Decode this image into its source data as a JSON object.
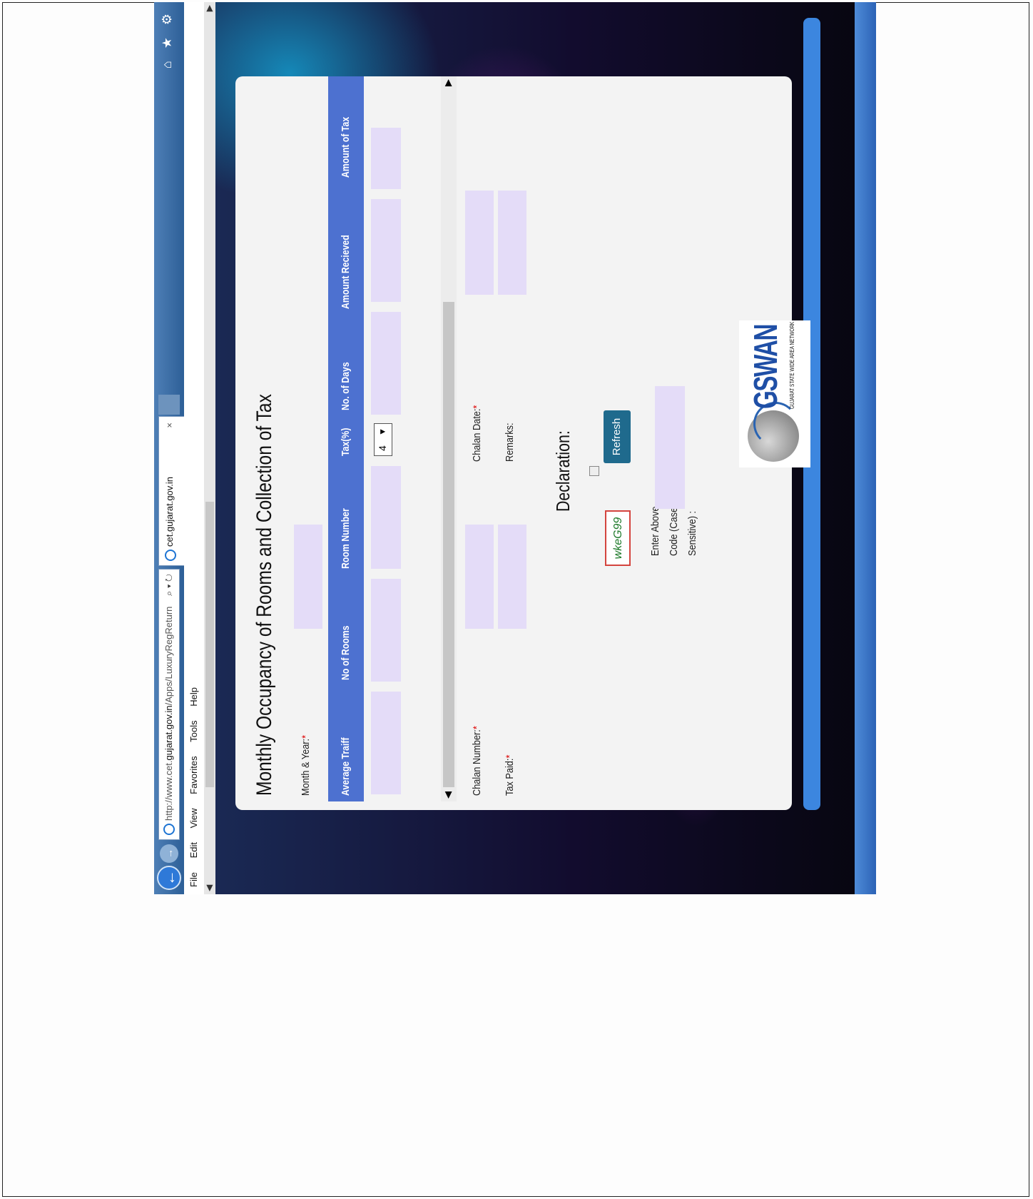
{
  "browser": {
    "url_prefix": "http://www.cet.",
    "url_domain": "gujarat.gov.in",
    "url_path": "/Apps/LuxuryRegReturn",
    "url_tools": "⌕ ▾ ↻",
    "tab_title": "cet.gujarat.gov.in",
    "tab_close": "×",
    "corner_icons": "⌂ ★ ⚙"
  },
  "menu": [
    "File",
    "Edit",
    "View",
    "Favorites",
    "Tools",
    "Help"
  ],
  "page": {
    "title": "Monthly Occupancy of Rooms and Collection of Tax",
    "month_year_label": "Month & Year:",
    "required_mark": "*",
    "grid_headers": [
      "Average Traiff",
      "No of Rooms",
      "Room Number",
      "Tax(%)",
      "No. of Days",
      "Amount Recieved",
      "Amount of Tax"
    ],
    "tax_percent_value": "4",
    "chalan_number_label": "Chalan Number:",
    "chalan_date_label": "Chalan Date:",
    "tax_paid_label": "Tax Paid:",
    "remarks_label": "Remarks:",
    "declaration_heading": "Declaration:",
    "captcha_code": "wkeG99",
    "refresh_label": "Refresh",
    "captcha_label_1": "Enter Above",
    "captcha_label_2": "Code (Case",
    "captcha_label_3": "Sensitive) :"
  },
  "logo": {
    "word": "GSWAN",
    "subtitle": "GUJARAT STATE WIDE AREA NETWORK"
  },
  "colors": {
    "grid_header": "#4d71d0",
    "field_fill": "#e4dcf8",
    "refresh_button": "#1f6a8d",
    "required": "#dd0000"
  }
}
